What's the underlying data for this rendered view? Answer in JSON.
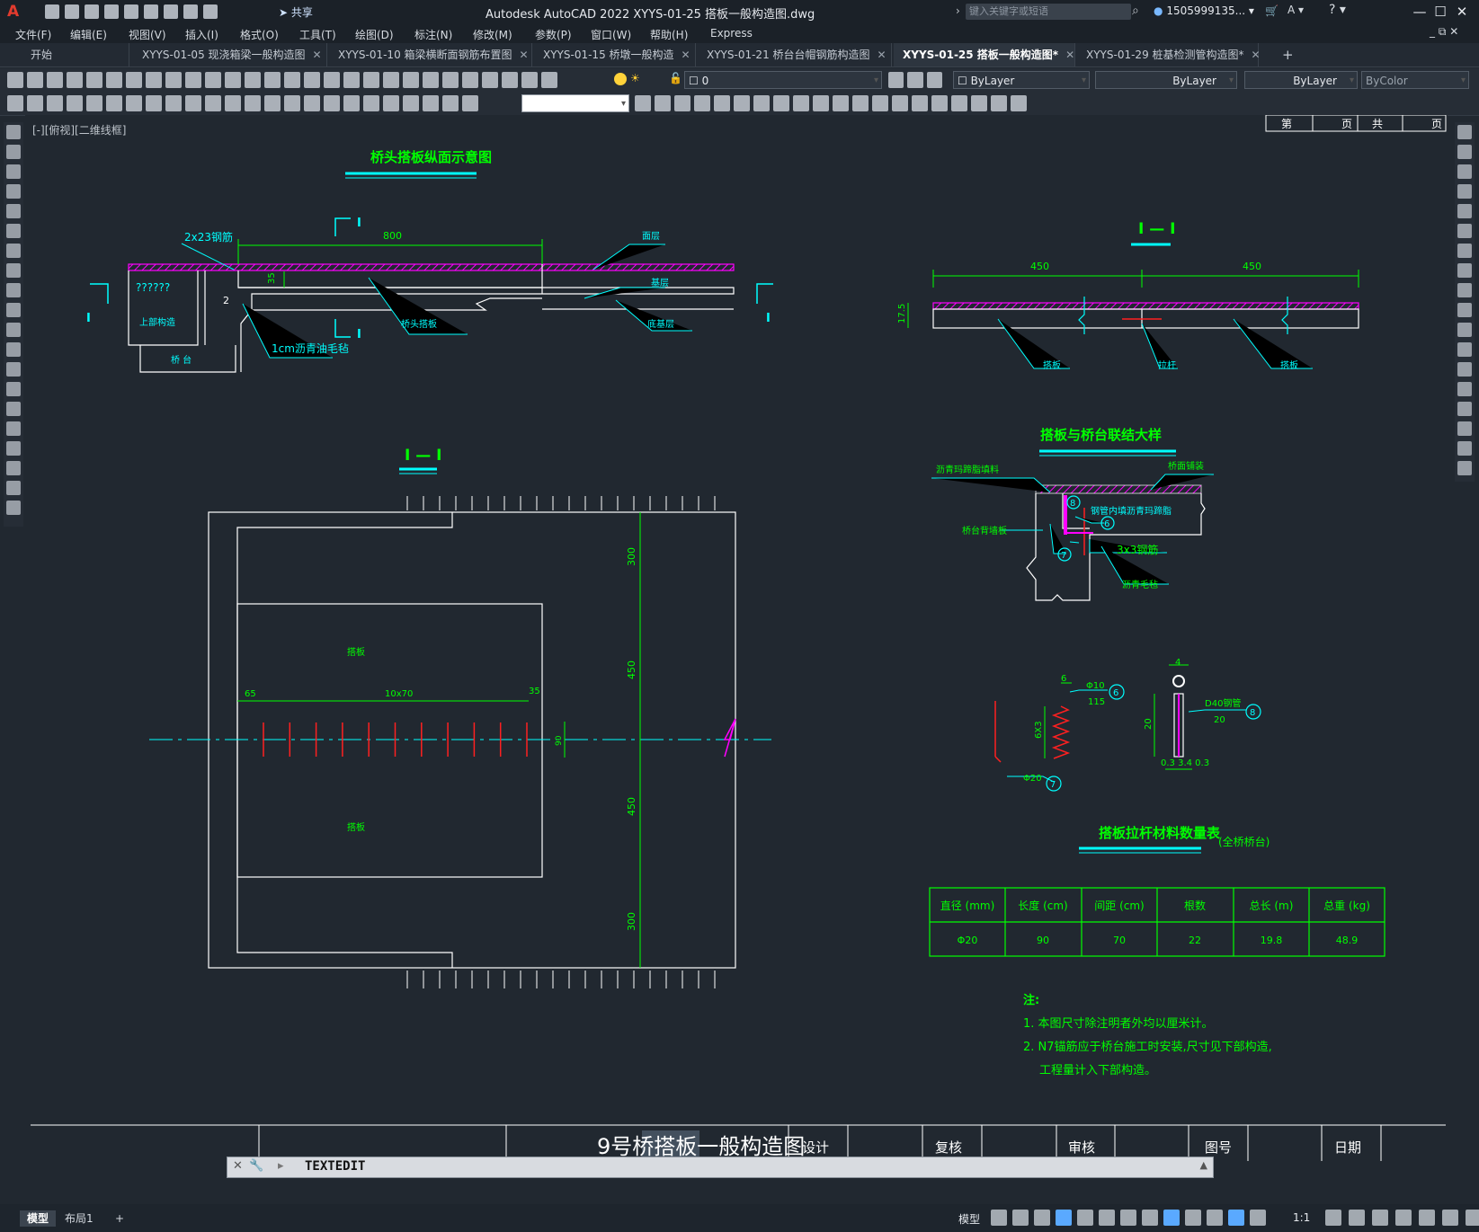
{
  "window": {
    "title": "Autodesk AutoCAD 2022    XYYS-01-25 搭板一般构造图.dwg",
    "app_logo": "A",
    "share_label": "共享",
    "search_placeholder": "键入关键字或短语",
    "user": "1505999135...",
    "buttons": [
      "—",
      "☐",
      "✕"
    ]
  },
  "menu": [
    "文件(F)",
    "编辑(E)",
    "视图(V)",
    "插入(I)",
    "格式(O)",
    "工具(T)",
    "绘图(D)",
    "标注(N)",
    "修改(M)",
    "参数(P)",
    "窗口(W)",
    "帮助(H)",
    "Express"
  ],
  "tabs": [
    {
      "label": "开始",
      "active": false
    },
    {
      "label": "XYYS-01-05 现浇箱梁一般构造图",
      "active": false
    },
    {
      "label": "XYYS-01-10 箱梁横断面钢筋布置图",
      "active": false
    },
    {
      "label": "XYYS-01-15 桥墩一般构造",
      "active": false
    },
    {
      "label": "XYYS-01-21 桥台台帽钢筋构造图",
      "active": false
    },
    {
      "label": "XYYS-01-25 搭板一般构造图*",
      "active": true
    },
    {
      "label": "XYYS-01-29 桩基检测管构造图*",
      "active": false
    }
  ],
  "properties": {
    "layer": "0",
    "color": "ByLayer",
    "linetype": "ByLayer",
    "lineweight": "ByLayer",
    "plotstyle": "ByColor"
  },
  "viewport_label": "[-][俯视][二维线框]",
  "drawing": {
    "title_longitudinal": "桥头搭板纵面示意图",
    "title_section_a": "I — I",
    "title_section_b": "I — I",
    "title_detail": "搭板与桥台联结大样",
    "title_table": "搭板拉杆材料数量表",
    "table_subtitle": "(全桥桥台)",
    "labels": {
      "dim_2x23": "2x23钢筋",
      "dim_800": "800",
      "surface": "面层",
      "base_layer": "基层",
      "sub_base": "底基层",
      "approach_slab": "桥头搭板",
      "q_marks": "??????",
      "superstructure": "上部构造",
      "abutment": "桥   台",
      "asphalt_felt": "1cm沥青油毛毡",
      "dim_35": "35",
      "dim_2": "2",
      "sec_I": "I",
      "dim_450_a": "450",
      "dim_450_b": "450",
      "dim_175": "17.5",
      "slab_left": "搭板",
      "tie_bar": "拉杆",
      "slab_right": "搭板",
      "plan_slab_top": "搭板",
      "plan_slab_bottom": "搭板",
      "dim_65": "65",
      "dim_10x70": "10x70",
      "dim_35b": "35",
      "dim_300a": "300",
      "dim_450c": "450",
      "dim_450d": "450",
      "dim_300b": "300",
      "dim_90": "90",
      "d_asphalt_seal": "沥青玛蹄脂填料",
      "d_bridge_deck": "桥面铺装",
      "d_tube_fill": "钢管内填沥青玛蹄脂",
      "d_back_wall": "桥台背墙板",
      "d_3x3": "3x3钢筋",
      "d_felt": "沥青毛毡",
      "n6": "6",
      "n7": "7",
      "n8": "8",
      "p_6": "6",
      "p_phi10": "Φ10",
      "p_115": "115",
      "p_6x3": "6X3",
      "p_phi20": "Φ20",
      "p_4": "4",
      "p_20": "20",
      "p_d40": "D40钢管",
      "p_20b": "20",
      "p_034": "0.3 3.4 0.3"
    },
    "table": {
      "headers": [
        "直径 (mm)",
        "长度 (cm)",
        "间距 (cm)",
        "根数",
        "总长 (m)",
        "总重 (kg)"
      ],
      "row": [
        "Φ20",
        "90",
        "70",
        "22",
        "19.8",
        "48.9"
      ]
    },
    "notes": {
      "title": "注:",
      "n1": "1. 本图尺寸除注明者外均以厘米计。",
      "n2": "2. N7锚筋应于桥台施工时安装,尺寸见下部构造,",
      "n3": "工程量计入下部构造。"
    },
    "titleblock": {
      "drawing_name": "9号桥搭板一般构造图",
      "design": "设计",
      "review": "复核",
      "approve": "审核",
      "drawing_no": "图号",
      "date": "日期",
      "sheet": [
        "第",
        "页",
        "共",
        "页"
      ]
    }
  },
  "command_line": {
    "text": "TEXTEDIT"
  },
  "status": {
    "layout_tabs": [
      "模型",
      "布局1",
      "+"
    ],
    "model_label": "模型",
    "scale": "1:1"
  },
  "colors": {
    "green": "#00ff00",
    "cyan": "#00ffff",
    "magenta": "#ff00ff",
    "red": "#ff2020",
    "white": "#ffffff",
    "canvas": "#212830"
  }
}
